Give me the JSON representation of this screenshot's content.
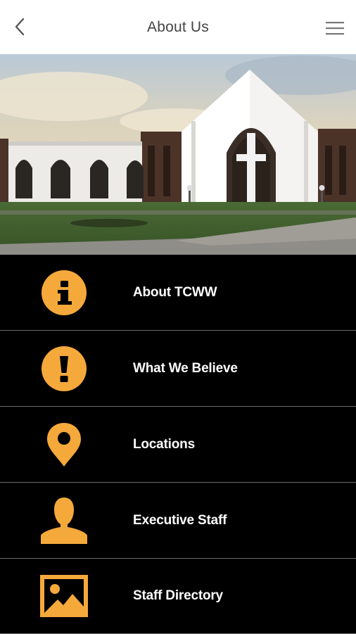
{
  "header": {
    "title": "About Us",
    "back_icon": "chevron-left-icon",
    "menu_icon": "hamburger-menu-icon"
  },
  "hero": {
    "description_icon": "church-photo"
  },
  "colors": {
    "accent": "#F5A93B",
    "background": "#000000",
    "header_bg": "#FFFFFF",
    "divider": "#6B6B6B"
  },
  "menu": {
    "items": [
      {
        "label": "About TCWW",
        "icon": "info-icon"
      },
      {
        "label": "What We Believe",
        "icon": "exclamation-icon"
      },
      {
        "label": "Locations",
        "icon": "map-pin-icon"
      },
      {
        "label": "Executive Staff",
        "icon": "person-icon"
      },
      {
        "label": "Staff Directory",
        "icon": "image-icon"
      }
    ]
  }
}
